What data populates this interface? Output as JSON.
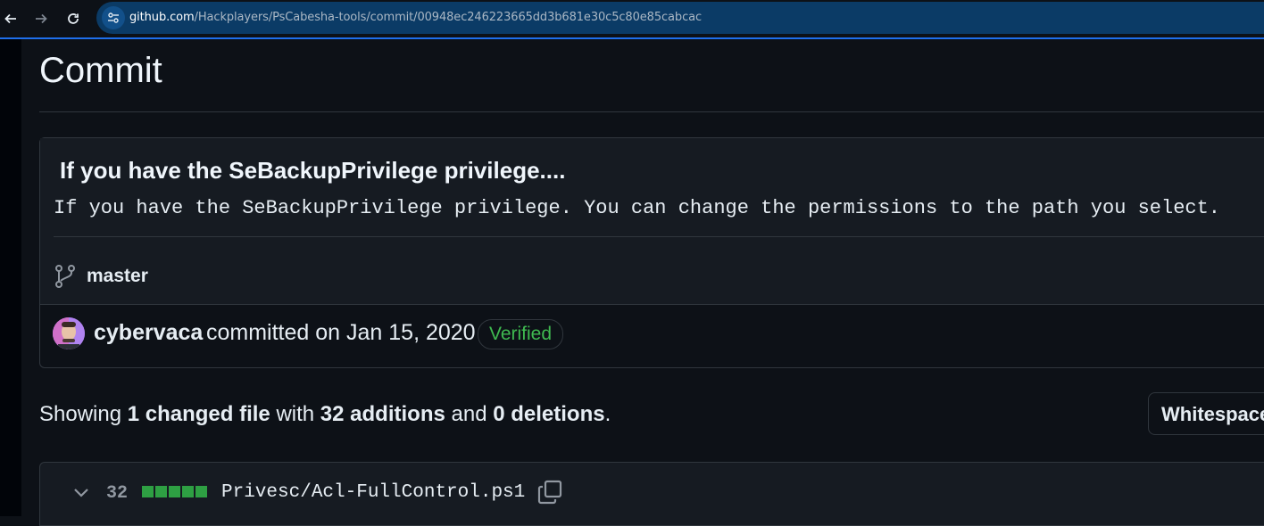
{
  "browser": {
    "url_host": "github.com",
    "url_path": "/Hackplayers/PsCabesha-tools/commit/00948ec246223665dd3b681e30c5c80e85cabcac"
  },
  "page": {
    "title": "Commit"
  },
  "commit": {
    "title": "If you have the SeBackupPrivilege privilege....",
    "description": "If you have the SeBackupPrivilege privilege. You can change the permissions to the path you select.",
    "branch": "master",
    "author": "cybervaca",
    "committed_text": "committed on Jan 15, 2020",
    "verified_label": "Verified"
  },
  "summary": {
    "prefix": "Showing ",
    "changed": "1 changed file",
    "with": " with ",
    "additions": "32 additions",
    "and": " and ",
    "deletions": "0 deletions",
    "suffix": "."
  },
  "whitespace_button": "Whitespace",
  "file": {
    "change_count": "32",
    "name": "Privesc/Acl-FullControl.ps1",
    "diffstat_additions_blocks": 5
  },
  "colors": {
    "accent": "#1f6feb",
    "verified": "#3fb950",
    "diff_add": "#2ea043"
  }
}
